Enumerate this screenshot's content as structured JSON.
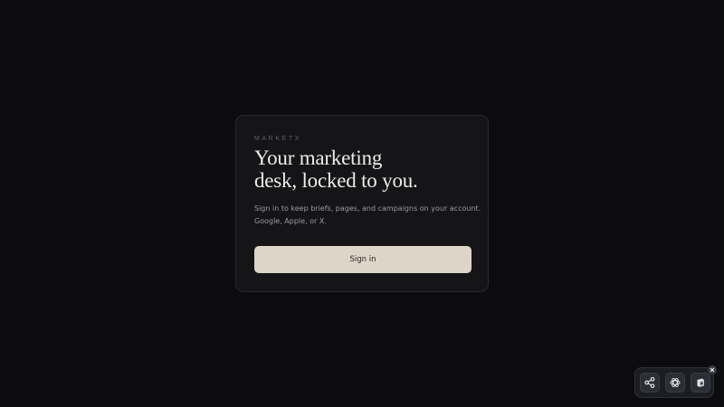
{
  "card": {
    "brand": "MARKETX",
    "headline_line1": "Your marketing",
    "headline_line2": "desk, locked to you.",
    "description_line1": "Sign in to keep briefs, pages, and campaigns on your account.",
    "description_line2": "Google, Apple, or X.",
    "sign_in_label": "Sign in"
  },
  "widget": {
    "icons": [
      "share-icon",
      "openai-icon",
      "cube-icon",
      "close-icon"
    ]
  },
  "colors": {
    "background": "#0c0c0e",
    "card": "#151518",
    "button": "#ddd5c8"
  }
}
